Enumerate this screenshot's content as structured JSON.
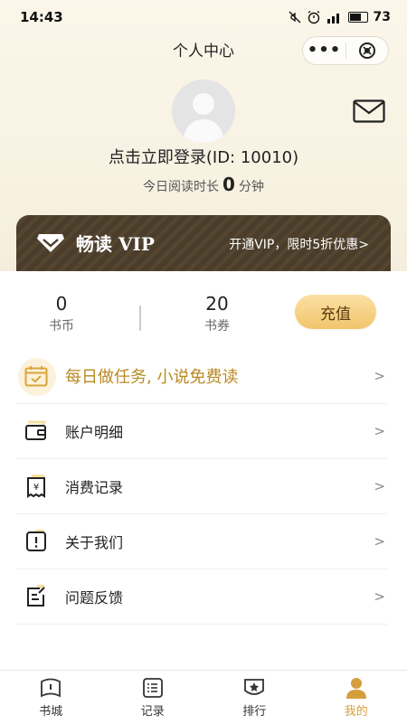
{
  "status_bar": {
    "time": "14:43",
    "battery": "73"
  },
  "nav": {
    "title": "个人中心",
    "more": "•••"
  },
  "profile": {
    "login_text": "点击立即登录(ID: 10010)",
    "reading_prefix": "今日阅读时长",
    "reading_minutes": "0",
    "reading_unit": "分钟"
  },
  "vip": {
    "title": "畅读 VIP",
    "promo": "开通VIP，限时5折优惠>"
  },
  "stats": {
    "coins_value": "0",
    "coins_label": "书币",
    "vouchers_value": "20",
    "vouchers_label": "书券",
    "recharge_label": "充值"
  },
  "menu": {
    "task": "每日做任务, 小说免费读",
    "items": [
      {
        "label": "账户明细"
      },
      {
        "label": "消费记录"
      },
      {
        "label": "关于我们"
      },
      {
        "label": "问题反馈"
      }
    ],
    "arrow": ">"
  },
  "tabs": [
    {
      "label": "书城"
    },
    {
      "label": "记录"
    },
    {
      "label": "排行"
    },
    {
      "label": "我的"
    }
  ],
  "colors": {
    "accent": "#d59e3d",
    "vip_bg": "#4a3d2c",
    "task_text": "#b98a22"
  }
}
